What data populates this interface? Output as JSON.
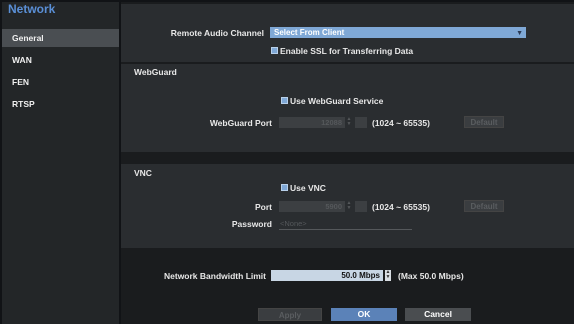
{
  "sidebar": {
    "title": "Network",
    "items": [
      {
        "label": "General"
      },
      {
        "label": "WAN"
      },
      {
        "label": "FEN"
      },
      {
        "label": "RTSP"
      }
    ]
  },
  "general": {
    "remote_audio_label": "Remote Audio Channel",
    "remote_audio_value": "Select From Client",
    "ssl_label": "Enable SSL for Transferring Data"
  },
  "webguard": {
    "title": "WebGuard",
    "use_label": "Use WebGuard Service",
    "port_label": "WebGuard Port",
    "port_value": "12088",
    "range": "(1024 ~ 65535)",
    "default_label": "Default"
  },
  "vnc": {
    "title": "VNC",
    "use_label": "Use VNC",
    "port_label": "Port",
    "port_value": "5900",
    "range": "(1024 ~ 65535)",
    "default_label": "Default",
    "password_label": "Password",
    "password_value": "<None>"
  },
  "bandwidth": {
    "label": "Network Bandwidth Limit",
    "value": "50.0 Mbps",
    "max": "(Max 50.0 Mbps)"
  },
  "footer": {
    "apply": "Apply",
    "ok": "OK",
    "cancel": "Cancel"
  },
  "colors": {
    "accent": "#7fa8d6",
    "title": "#5a8fd6",
    "ok": "#5b82b8"
  }
}
